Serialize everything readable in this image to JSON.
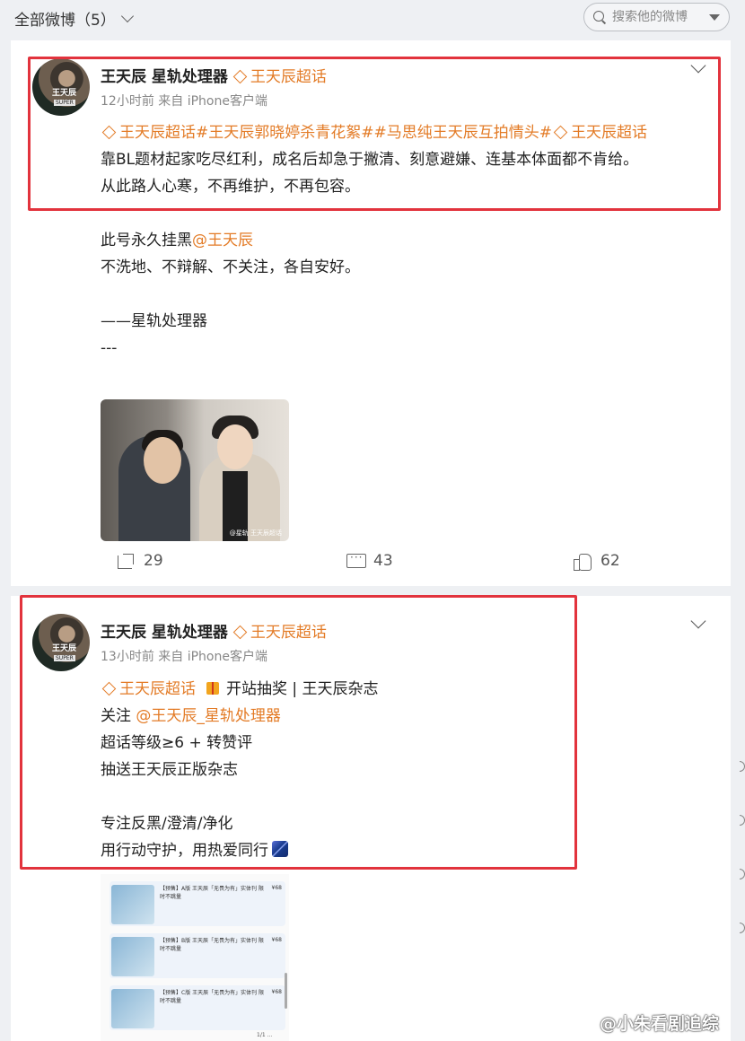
{
  "topbar": {
    "filter_label": "全部微博（5）",
    "search_placeholder": "搜索他的微博"
  },
  "colors": {
    "link": "#e37b26",
    "highlight_box": "#e2333d",
    "text": "#222222",
    "meta": "#888888"
  },
  "icons": [
    "chevron-down-icon",
    "search-icon",
    "dropdown-triangle-icon",
    "diamond-icon",
    "share-icon",
    "comment-icon",
    "like-icon",
    "gift-icon",
    "flag-emoji-icon"
  ],
  "posts": [
    {
      "author": "王天辰_星轨处理器",
      "author_display": "王天辰  星轨处理器",
      "supertopic": "王天辰超话",
      "meta": "12小时前  来自 iPhone客户端",
      "avatar_text": "王天辰",
      "avatar_tag": "SUPER",
      "lines": {
        "l1a": "王天辰超话#王天辰郭晓婷杀青花絮##马思纯王天辰互拍情头#",
        "l1b": "王天辰超话",
        "l2": "靠BL题材起家吃尽红利，成名后却急于撇清、刻意避嫌、连基本体面都不肯给。",
        "l3": "从此路人心寒，不再维护，不再包容。",
        "l5a": "此号永久挂黑",
        "l5b": "@王天辰",
        "l6": "不洗地、不辩解、不关注，各自安好。",
        "l8": "——星轨处理器",
        "l9": "---"
      },
      "photo_watermark": "@星轨 王天辰超话",
      "actions": {
        "reposts": "29",
        "comments": "43",
        "likes": "62"
      }
    },
    {
      "author": "王天辰_星轨处理器",
      "author_display": "王天辰  星轨处理器",
      "supertopic": "王天辰超话",
      "meta": "13小时前  来自 iPhone客户端",
      "avatar_text": "王天辰",
      "avatar_tag": "SUPER",
      "lines": {
        "l1a": "王天辰超话",
        "l1b": "开站抽奖 | 王天辰杂志",
        "l2a": "关注 ",
        "l2b": "@王天辰_星轨处理器",
        "l3": "超话等级≥6 + 转赞评",
        "l4": "抽送王天辰正版杂志",
        "l6": "专注反黑/澄清/净化",
        "l7": "用行动守护，用热爱同行"
      },
      "shop_items": [
        {
          "title": "【预售】A版 王天辰「无畏为有」实体刊 限时不跳量",
          "price": "¥68"
        },
        {
          "title": "【预售】B版 王天辰「无畏为有」实体刊 限时不跳量",
          "price": "¥68"
        },
        {
          "title": "【预售】C版 王天辰「无畏为有」实体刊 限时不跳量",
          "price": "¥68"
        }
      ],
      "shop_note": "1/1 ..."
    }
  ],
  "watermark": "@小朱看剧追综"
}
